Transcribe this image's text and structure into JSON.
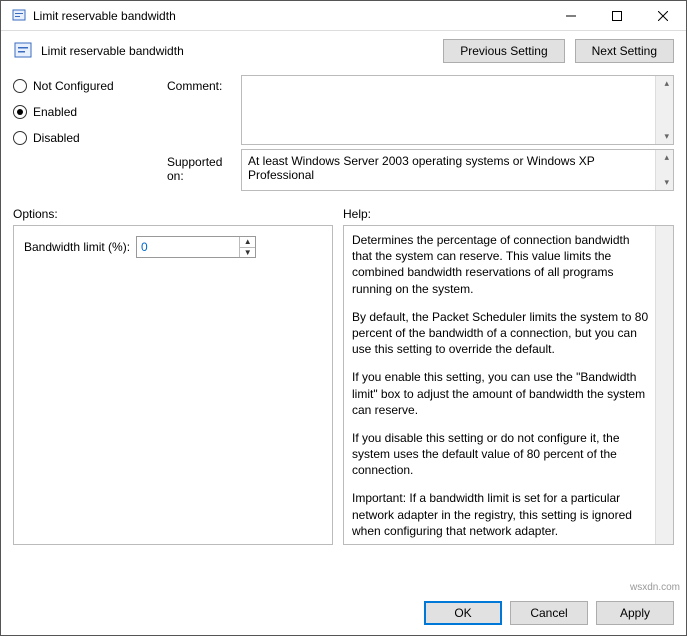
{
  "window": {
    "title": "Limit reservable bandwidth",
    "min": "—",
    "max": "▢",
    "close": "✕"
  },
  "header": {
    "title": "Limit reservable bandwidth",
    "previous": "Previous Setting",
    "next": "Next Setting"
  },
  "config": {
    "radios": {
      "not_configured": "Not Configured",
      "enabled": "Enabled",
      "disabled": "Disabled",
      "selected": "enabled"
    },
    "comment_label": "Comment:",
    "comment_value": "",
    "supported_label": "Supported on:",
    "supported_value": "At least Windows Server 2003 operating systems or Windows XP Professional"
  },
  "options": {
    "heading": "Options:",
    "bandwidth_label": "Bandwidth limit (%):",
    "bandwidth_value": "0"
  },
  "help": {
    "heading": "Help:",
    "p1": "Determines the percentage of connection bandwidth that the system can reserve. This value limits the combined bandwidth reservations of all programs running on the system.",
    "p2": "By default, the Packet Scheduler limits the system to 80 percent of the bandwidth of a connection, but you can use this setting to override the default.",
    "p3": "If you enable this setting, you can use the \"Bandwidth limit\" box to adjust the amount of bandwidth the system can reserve.",
    "p4": "If you disable this setting or do not configure it, the system uses the default value of 80 percent of the connection.",
    "p5": "Important: If a bandwidth limit is set for a particular network adapter in the registry, this setting is ignored when configuring that network adapter."
  },
  "footer": {
    "ok": "OK",
    "cancel": "Cancel",
    "apply": "Apply"
  },
  "watermark": "wsxdn.com"
}
